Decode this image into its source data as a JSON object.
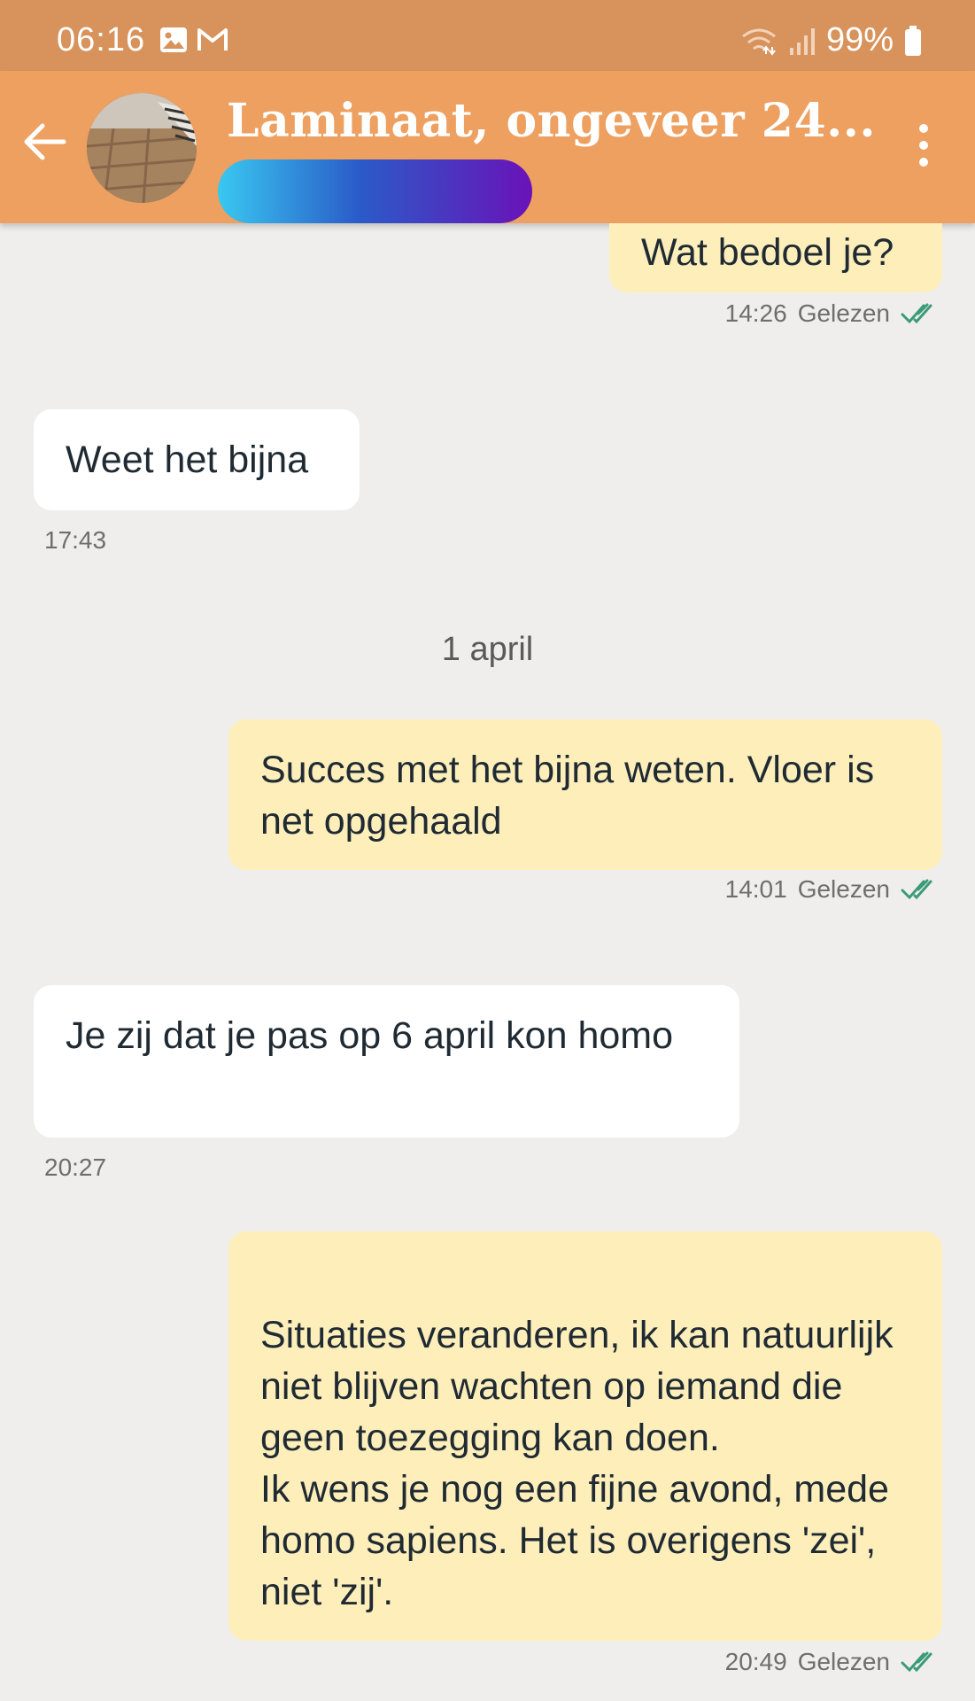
{
  "status_bar": {
    "time": "06:16",
    "battery": "99%"
  },
  "header": {
    "title": "Laminaat, ongeveer 24..."
  },
  "messages": [
    {
      "direction": "out",
      "text": "Wat bedoel je?",
      "time": "14:26",
      "status": "Gelezen"
    },
    {
      "direction": "in",
      "text": "Weet het bijna",
      "time": "17:43"
    },
    {
      "direction": "out",
      "text": "Succes met het bijna weten. Vloer is net opgehaald",
      "time": "14:01",
      "status": "Gelezen"
    },
    {
      "direction": "in",
      "text": "Je zij dat je pas op 6 april kon homo",
      "time": "20:27"
    },
    {
      "direction": "out",
      "text": "Situaties veranderen, ik kan natuurlijk niet blijven wachten op iemand die geen toezegging kan doen.\nIk wens je nog een fijne avond, mede homo sapiens. Het is overigens 'zei', niet 'zij'.",
      "time": "20:49",
      "status": "Gelezen"
    }
  ],
  "date_separator": "1 april",
  "colors": {
    "header": "#eda060",
    "status_bar": "#d8935c",
    "outgoing_bubble": "#fdeeba",
    "incoming_bubble": "#ffffff",
    "read_ticks": "#3a9a7a"
  },
  "icons": [
    "back-arrow-icon",
    "image-icon",
    "gmail-icon",
    "wifi-icon",
    "signal-icon",
    "battery-icon",
    "more-vert-icon",
    "double-check-icon"
  ]
}
